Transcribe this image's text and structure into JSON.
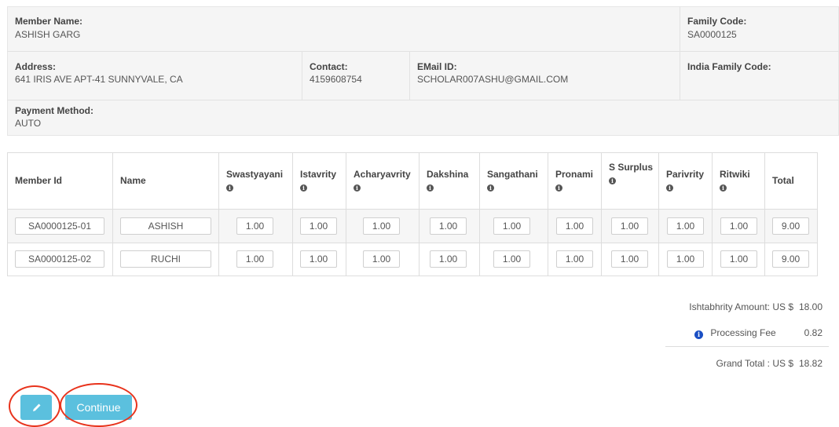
{
  "member_info": {
    "member_name_label": "Member Name:",
    "member_name": "ASHISH GARG",
    "family_code_label": "Family Code:",
    "family_code": "SA0000125",
    "address_label": "Address:",
    "address": "641 IRIS AVE APT-41 SUNNYVALE, CA",
    "contact_label": "Contact:",
    "contact": "4159608754",
    "email_label": "EMail ID:",
    "email": "SCHOLAR007ASHU@GMAIL.COM",
    "india_family_code_label": "India Family Code:",
    "payment_method_label": "Payment Method:",
    "payment_method": "AUTO"
  },
  "table": {
    "headers": [
      "Member Id",
      "Name",
      "Swastyayani",
      "Istavrity",
      "Acharyavrity",
      "Dakshina",
      "Sangathani",
      "Pronami",
      "S Surplus",
      "Parivrity",
      "Ritwiki",
      "Total"
    ],
    "rows": [
      {
        "member_id": "SA0000125-01",
        "name": "ASHISH",
        "values": [
          "1.00",
          "1.00",
          "1.00",
          "1.00",
          "1.00",
          "1.00",
          "1.00",
          "1.00",
          "1.00"
        ],
        "total": "9.00"
      },
      {
        "member_id": "SA0000125-02",
        "name": "RUCHI",
        "values": [
          "1.00",
          "1.00",
          "1.00",
          "1.00",
          "1.00",
          "1.00",
          "1.00",
          "1.00",
          "1.00"
        ],
        "total": "9.00"
      }
    ]
  },
  "summary": {
    "ishtabhrity_label": "Ishtabhrity Amount: US $",
    "ishtabhrity_value": "18.00",
    "processing_fee_label": "Processing Fee",
    "processing_fee_value": "0.82",
    "grand_total_label": "Grand Total : US $",
    "grand_total_value": "18.82"
  },
  "buttons": {
    "continue_label": "Continue",
    "edit_icon": "pencil-icon"
  },
  "colors": {
    "button": "#5bc0de",
    "highlight_ring": "#e8331c",
    "info_icon": "#1a4fc4"
  }
}
